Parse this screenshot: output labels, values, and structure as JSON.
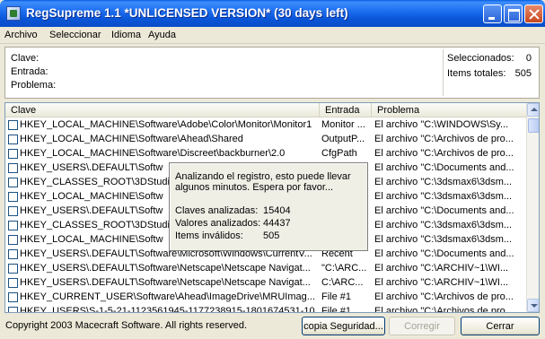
{
  "window": {
    "title": "RegSupreme 1.1 *UNLICENSED VERSION* (30 days left)"
  },
  "menu": [
    "Archivo",
    "Seleccionar",
    "Idioma",
    "Ayuda"
  ],
  "info": {
    "clave_label": "Clave:",
    "entrada_label": "Entrada:",
    "problema_label": "Problema:",
    "seleccionados_label": "Seleccionados:",
    "seleccionados_value": "0",
    "items_label": "Items totales:",
    "items_value": "505"
  },
  "list": {
    "headers": {
      "clave": "Clave",
      "entrada": "Entrada",
      "problema": "Problema"
    },
    "rows": [
      {
        "clave": "HKEY_LOCAL_MACHINE\\Software\\Adobe\\Color\\Monitor\\Monitor1",
        "entrada": "Monitor ...",
        "problema": "El archivo \"C:\\WINDOWS\\Sy..."
      },
      {
        "clave": "HKEY_LOCAL_MACHINE\\Software\\Ahead\\Shared",
        "entrada": "OutputP...",
        "problema": "El archivo \"C:\\Archivos de pro..."
      },
      {
        "clave": "HKEY_LOCAL_MACHINE\\Software\\Discreet\\backburner\\2.0",
        "entrada": "CfgPath",
        "problema": "El archivo \"C:\\Archivos de pro..."
      },
      {
        "clave": "HKEY_USERS\\.DEFAULT\\Softw",
        "entrada": "",
        "problema": "El archivo \"C:\\Documents and..."
      },
      {
        "clave": "HKEY_CLASSES_ROOT\\3DStudi",
        "entrada": "",
        "problema": "El archivo \"C:\\3dsmax6\\3dsm..."
      },
      {
        "clave": "HKEY_LOCAL_MACHINE\\Softw",
        "entrada": "",
        "problema": "El archivo \"C:\\3dsmax6\\3dsm..."
      },
      {
        "clave": "HKEY_USERS\\.DEFAULT\\Softw",
        "entrada": "",
        "problema": "El archivo \"C:\\Documents and..."
      },
      {
        "clave": "HKEY_CLASSES_ROOT\\3DStudi",
        "entrada": "",
        "problema": "El archivo \"C:\\3dsmax6\\3dsm..."
      },
      {
        "clave": "HKEY_LOCAL_MACHINE\\Softw",
        "entrada": "",
        "problema": "El archivo \"C:\\3dsmax6\\3dsm..."
      },
      {
        "clave": "HKEY_USERS\\.DEFAULT\\Software\\Microsoft\\Windows\\CurrentV...",
        "entrada": "Recent",
        "problema": "El archivo \"C:\\Documents and..."
      },
      {
        "clave": "HKEY_USERS\\.DEFAULT\\Software\\Netscape\\Netscape Navigat...",
        "entrada": "\"C:\\ARC...",
        "problema": "El archivo \"C:\\ARCHIV~1\\WI..."
      },
      {
        "clave": "HKEY_USERS\\.DEFAULT\\Software\\Netscape\\Netscape Navigat...",
        "entrada": "C:\\ARC...",
        "problema": "El archivo \"C:\\ARCHIV~1\\WI..."
      },
      {
        "clave": "HKEY_CURRENT_USER\\Software\\Ahead\\ImageDrive\\MRUImag...",
        "entrada": "File #1",
        "problema": "El archivo \"C:\\Archivos de pro..."
      },
      {
        "clave": "HKEY_USERS\\S-1-5-21-1123561945-1177238915-1801674531-10...",
        "entrada": "File #1",
        "problema": "El archivo \"C:\\Archivos de pro..."
      }
    ]
  },
  "popup": {
    "message": "Analizando el registro, esto puede llevar algunos minutos. Espera por favor...",
    "claves_label": "Claves analizadas:",
    "claves_value": "15404",
    "valores_label": "Valores analizados:",
    "valores_value": "44437",
    "invalidos_label": "Items inválidos:",
    "invalidos_value": "505"
  },
  "footer": {
    "copyright": "Copyright 2003 Macecraft Software. All rights reserved.",
    "backup_label": "copia Seguridad...",
    "fix_label": "Corregir",
    "close_label": "Cerrar"
  }
}
